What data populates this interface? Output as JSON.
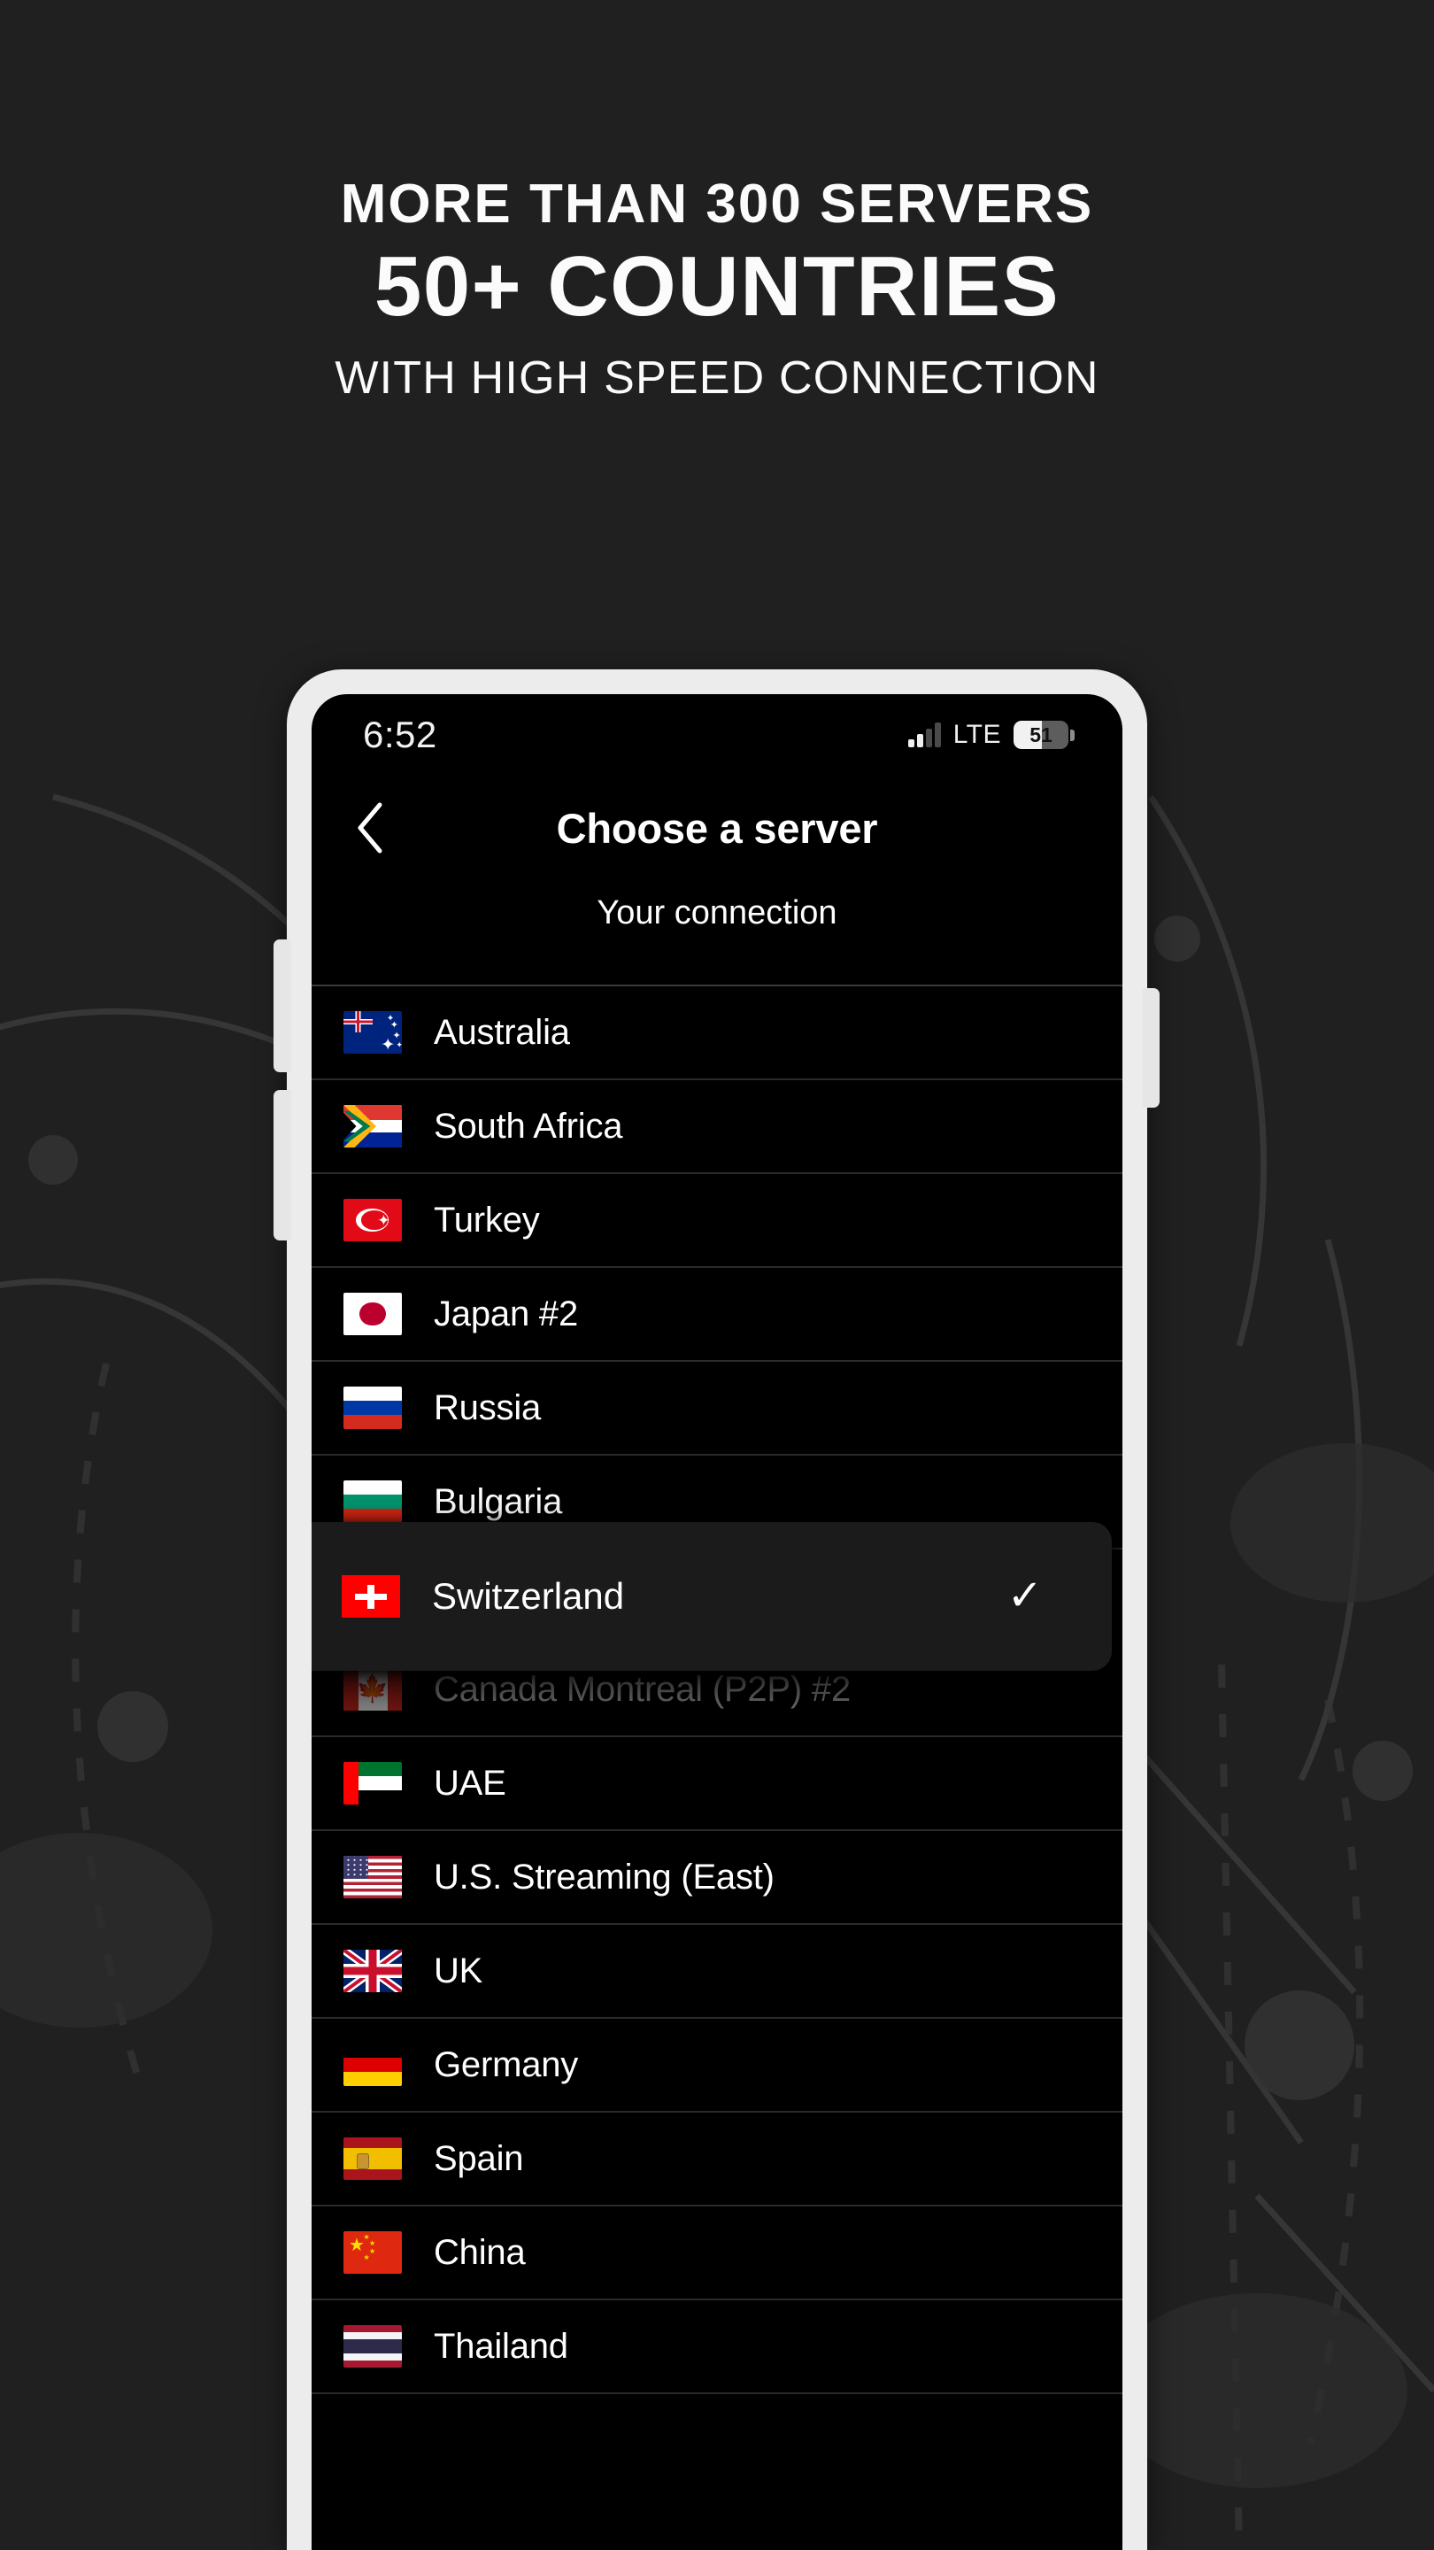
{
  "promo": {
    "line1": "MORE THAN 300 SERVERS",
    "line2": "50+ COUNTRIES",
    "line3": "WITH HIGH SPEED CONNECTION",
    "background_color": "#202020",
    "text_color": "#fbfbfb"
  },
  "phone": {
    "frame_color": "#ececec",
    "screen_color": "#000000"
  },
  "status_bar": {
    "time": "6:52",
    "network_type": "LTE",
    "battery_percent": "51",
    "signal_bars": 4
  },
  "nav": {
    "back_icon": "chevron-left-icon",
    "title": "Choose a server",
    "subtitle": "Your connection"
  },
  "selected": {
    "label": "Switzerland",
    "flag": "ch",
    "check_icon": "check-icon",
    "card_color": "#1b1b1b"
  },
  "servers": [
    {
      "label": "Australia",
      "flag": "au",
      "dimmed": false
    },
    {
      "label": "South Africa",
      "flag": "za",
      "dimmed": false
    },
    {
      "label": "Turkey",
      "flag": "tr",
      "dimmed": false
    },
    {
      "label": "Japan #2",
      "flag": "jp",
      "dimmed": false
    },
    {
      "label": "Russia",
      "flag": "ru",
      "dimmed": false
    },
    {
      "label": "Bulgaria",
      "flag": "bg",
      "dimmed": false
    },
    {
      "label": "Switzerland",
      "flag": "ch",
      "dimmed": false
    },
    {
      "label": "Canada Montreal (P2P) #2",
      "flag": "ca",
      "dimmed": true
    },
    {
      "label": "UAE",
      "flag": "ae",
      "dimmed": false
    },
    {
      "label": "U.S. Streaming (East)",
      "flag": "us",
      "dimmed": false
    },
    {
      "label": "UK",
      "flag": "gb",
      "dimmed": false
    },
    {
      "label": "Germany",
      "flag": "de",
      "dimmed": false
    },
    {
      "label": "Spain",
      "flag": "es",
      "dimmed": false
    },
    {
      "label": "China",
      "flag": "cn",
      "dimmed": false
    },
    {
      "label": "Thailand",
      "flag": "th",
      "dimmed": false
    }
  ]
}
